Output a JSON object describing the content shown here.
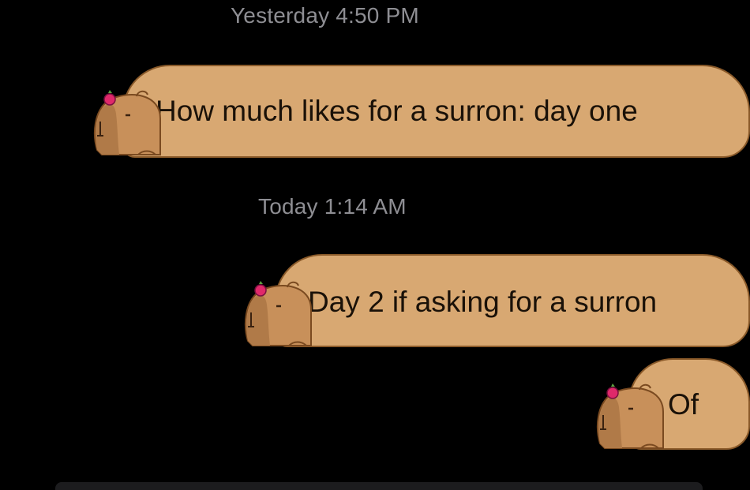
{
  "timestamps": [
    "Yesterday 4:50 PM",
    "Today 1:14 AM"
  ],
  "messages": [
    {
      "text": "How much likes for a surron: day one"
    },
    {
      "text": "Day 2 if asking for a surron"
    },
    {
      "text": "Of"
    }
  ],
  "colors": {
    "background": "#000000",
    "bubble": "#d8a872",
    "bubble_outline": "#8a5a2a",
    "timestamp": "#8e8e93",
    "capybara_accent": "#e0296a"
  },
  "icons": [
    "capybara-sticker-icon"
  ]
}
